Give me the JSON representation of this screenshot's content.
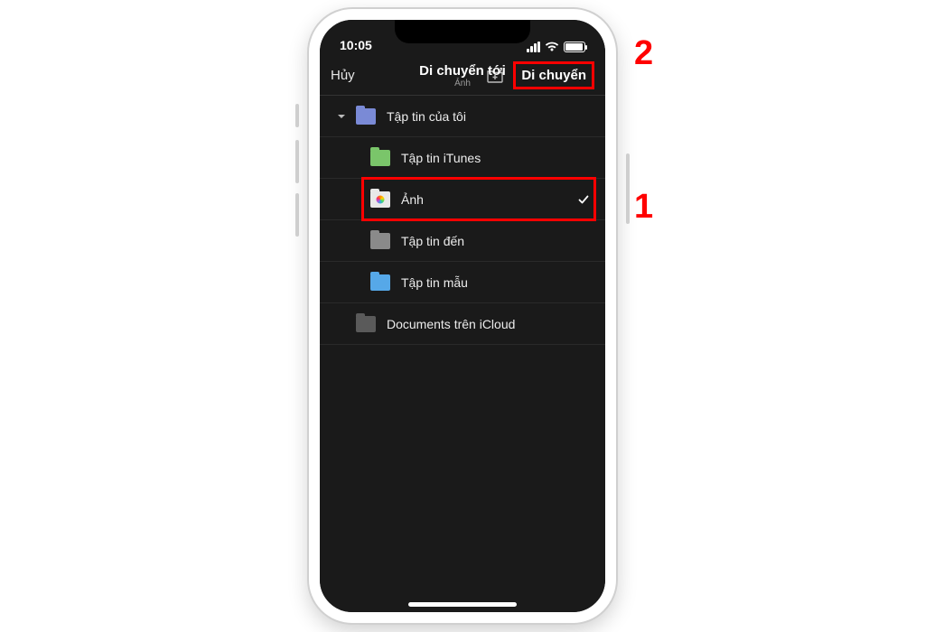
{
  "status": {
    "time": "10:05"
  },
  "nav": {
    "cancel": "Hủy",
    "title": "Di chuyển tới",
    "subtitle": "Ảnh",
    "add_folder_icon": "add-folder-icon",
    "move": "Di chuyển"
  },
  "root": {
    "label": "Tập tin của tôi",
    "expanded": true
  },
  "folders": [
    {
      "label": "Tập tin iTunes",
      "color": "folder-green",
      "selected": false
    },
    {
      "label": "Ảnh",
      "color": "folder-white",
      "selected": true
    },
    {
      "label": "Tập tin đến",
      "color": "folder-grey",
      "selected": false
    },
    {
      "label": "Tập tin mẫu",
      "color": "folder-sky",
      "selected": false
    }
  ],
  "icloud": {
    "label": "Documents trên iCloud"
  },
  "callouts": {
    "one": "1",
    "two": "2"
  }
}
